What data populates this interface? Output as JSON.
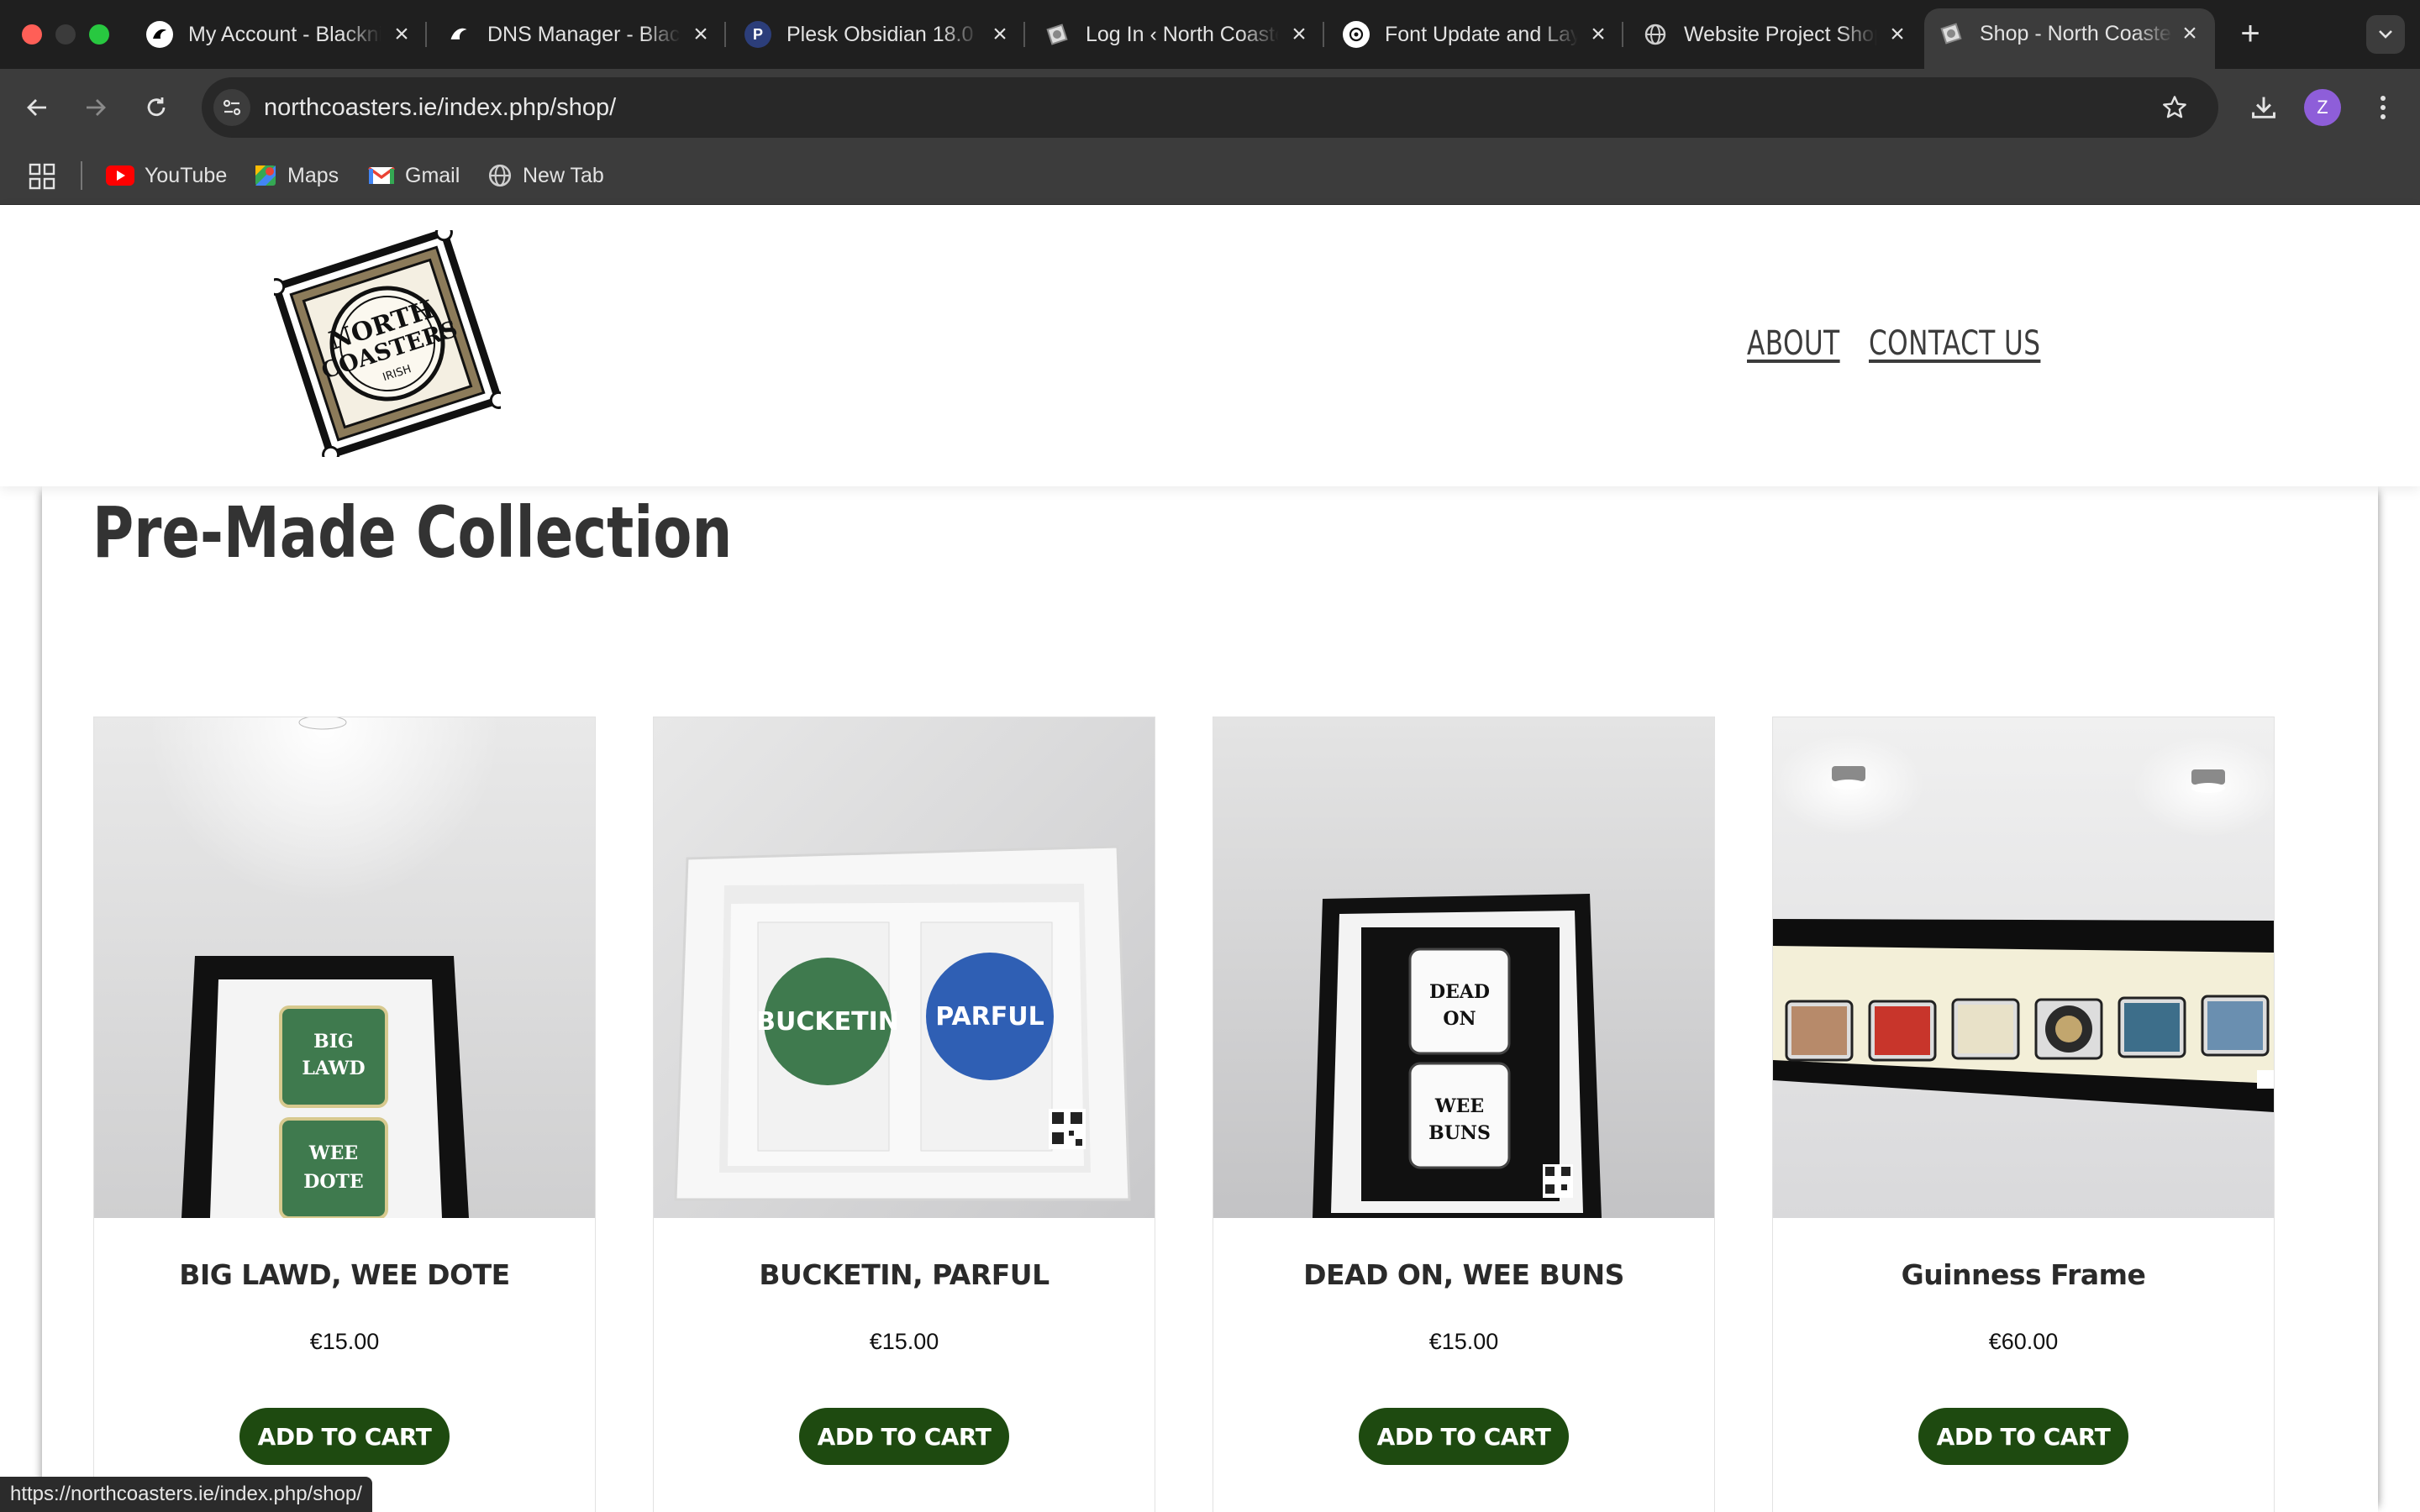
{
  "browser": {
    "tabs": [
      {
        "title": "My Account - Blacknight",
        "favicon": "blacknight-icon",
        "fav_letter": ""
      },
      {
        "title": "DNS Manager - Blacknight",
        "favicon": "blacknight-icon",
        "fav_letter": ""
      },
      {
        "title": "Plesk Obsidian 18.0",
        "favicon": "plesk-icon",
        "fav_letter": "P"
      },
      {
        "title": "Log In ‹ North Coasters",
        "favicon": "north-coasters-icon",
        "fav_letter": ""
      },
      {
        "title": "Font Update and Layout",
        "favicon": "openai-icon",
        "fav_letter": ""
      },
      {
        "title": "Website Project Shop",
        "favicon": "globe-icon",
        "fav_letter": ""
      },
      {
        "title": "Shop - North Coasters",
        "favicon": "north-coasters-icon",
        "fav_letter": "",
        "active": true
      }
    ],
    "url": "northcoasters.ie/index.php/shop/",
    "profile_initial": "Z",
    "bookmarks": [
      {
        "label": "YouTube",
        "icon": "youtube-icon"
      },
      {
        "label": "Maps",
        "icon": "maps-icon"
      },
      {
        "label": "Gmail",
        "icon": "gmail-icon"
      },
      {
        "label": "New Tab",
        "icon": "globe-icon"
      }
    ],
    "status_url": "https://northcoasters.ie/index.php/shop/"
  },
  "site": {
    "logo_text": "NORTH COASTERS IRISH",
    "nav": [
      "ABOUT",
      "CONTACT US"
    ]
  },
  "page": {
    "title": "Pre-Made Collection",
    "products": [
      {
        "name": "BIG LAWD, WEE DOTE",
        "price": "€15.00",
        "cart_label": "ADD TO CART",
        "coaster_words": [
          "BIG",
          "LAWD",
          "WEE",
          "DOTE"
        ]
      },
      {
        "name": "BUCKETIN, PARFUL",
        "price": "€15.00",
        "cart_label": "ADD TO CART",
        "coaster_words": [
          "BUCKETIN",
          "PARFUL"
        ]
      },
      {
        "name": "DEAD ON, WEE BUNS",
        "price": "€15.00",
        "cart_label": "ADD TO CART",
        "coaster_words": [
          "DEAD",
          "ON",
          "WEE",
          "BUNS"
        ]
      },
      {
        "name": "Guinness Frame",
        "price": "€60.00",
        "cart_label": "ADD TO CART",
        "coaster_words": []
      }
    ]
  },
  "colors": {
    "cart_button": "#1e4a10",
    "coaster_green": "#3f7a4e",
    "coaster_blue": "#2f5fb4"
  }
}
